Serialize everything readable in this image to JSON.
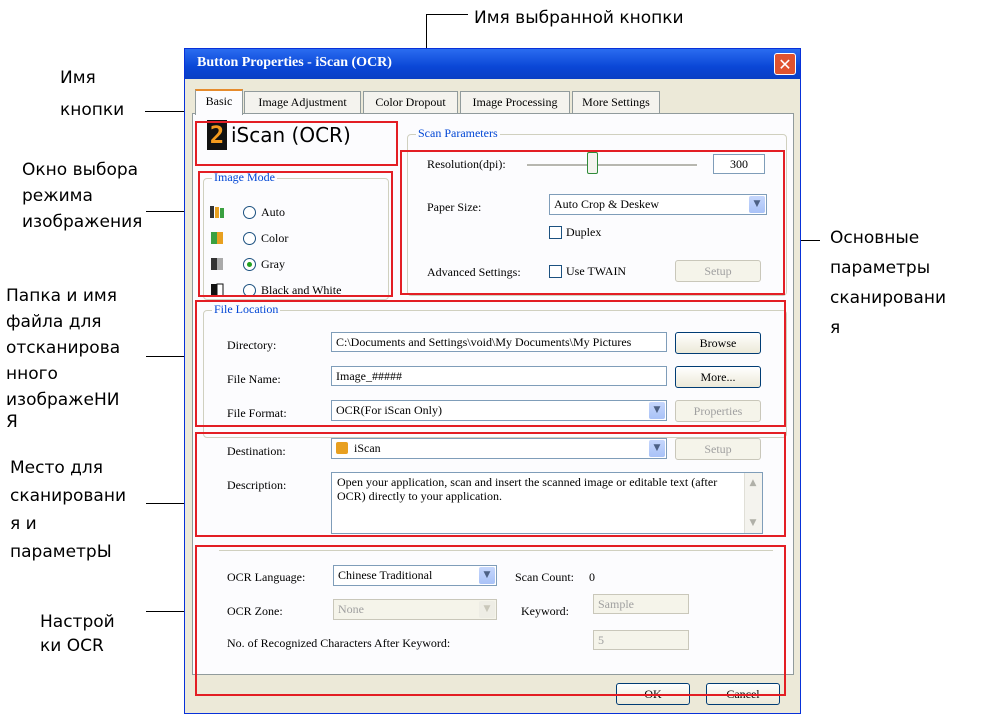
{
  "annotations": {
    "selected_button_name": "Имя выбранной кнопки",
    "button_name": [
      "Имя",
      "кнопки"
    ],
    "image_mode_window": [
      "Окно выбора",
      "режима",
      "изображения"
    ],
    "folder_and_file": [
      "Папка и имя",
      "файла для",
      "отсканирова",
      "нного",
      "изображеНИ",
      "Я"
    ],
    "destination_params": [
      "Место для",
      "сканировани",
      "я и",
      "параметрЫ"
    ],
    "ocr_settings": [
      "Настрой",
      "ки OCR"
    ],
    "scan_params": [
      "Основные",
      "параметры",
      "сканировани",
      "я"
    ]
  },
  "dialog": {
    "title": "Button Properties - iScan (OCR)",
    "close_glyph": "✕",
    "tabs": [
      "Basic",
      "Image Adjustment",
      "Color Dropout",
      "Image Processing",
      "More Settings"
    ],
    "active_tab": "Basic"
  },
  "button_badge": {
    "number": "2",
    "name": "iScan (OCR)"
  },
  "image_mode": {
    "legend": "Image Mode",
    "options": [
      "Auto",
      "Color",
      "Gray",
      "Black and White"
    ],
    "selected": "Gray"
  },
  "scan_parameters": {
    "legend": "Scan Parameters",
    "resolution_label": "Resolution(dpi):",
    "resolution_value": "300",
    "resolution_slider_fraction": 0.38,
    "paper_size_label": "Paper Size:",
    "paper_size_value": "Auto Crop & Deskew",
    "duplex_label": "Duplex",
    "advanced_label": "Advanced Settings:",
    "use_twain_label": "Use TWAIN",
    "setup_label": "Setup"
  },
  "file_location": {
    "legend": "File Location",
    "directory_label": "Directory:",
    "directory_value": "C:\\Documents and Settings\\void\\My Documents\\My Pictures",
    "browse_label": "Browse",
    "file_name_label": "File Name:",
    "file_name_value": "Image_#####",
    "more_label": "More...",
    "file_format_label": "File Format:",
    "file_format_value": "OCR(For iScan Only)",
    "properties_label": "Properties"
  },
  "destination": {
    "label": "Destination:",
    "value": "iScan",
    "setup_label": "Setup",
    "description_label": "Description:",
    "description_value": "Open your application, scan and insert the scanned image or editable text (after OCR) directly to your application."
  },
  "ocr": {
    "language_label": "OCR Language:",
    "language_value": "Chinese Traditional",
    "scan_count_label": "Scan Count:",
    "scan_count_value": "0",
    "zone_label": "OCR Zone:",
    "zone_value": "None",
    "keyword_label": "Keyword:",
    "keyword_value": "Sample",
    "chars_label": "No. of Recognized Characters After Keyword:",
    "chars_value": "5"
  },
  "footer": {
    "ok_label": "OK",
    "cancel_label": "Cancel"
  },
  "colors": {
    "annotation_red": "#e31e24",
    "titlebar_blue": "#0a46d6",
    "legend_blue": "#0046d5"
  }
}
